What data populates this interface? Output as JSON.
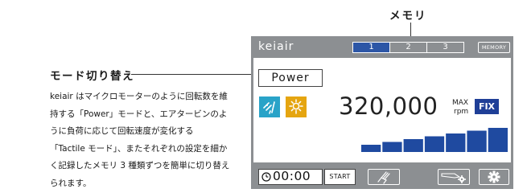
{
  "annotations": {
    "mode_title": "モード切り替え",
    "memory_title": "メモリ",
    "description_lines": [
      "keiair はマイクロモーターのように回転数を維",
      "持する「Power」モードと、エアタービンのよ",
      "うに負荷に応じて回転速度が変化する",
      "「Tactile モード」、またそれぞれの設定を細か",
      "く記録したメモリ 3 種類ずつを簡単に切り替え",
      "られます。"
    ]
  },
  "screen": {
    "title": "keiair",
    "memory_buttons": [
      {
        "label": "1",
        "active": true
      },
      {
        "label": "2",
        "active": false
      },
      {
        "label": "3",
        "active": false
      }
    ],
    "memory_button_label": "MEMORY",
    "mode_label": "Power",
    "speed_value": "320,000",
    "speed_unit_top": "MAX",
    "speed_unit_bottom": "rpm",
    "fix_label": "FIX",
    "speed_level": 1.0,
    "timer_value": "00:00",
    "start_label": "START",
    "icons": {
      "motor": "motor-icon",
      "light": "light-icon",
      "timer": "clock-icon",
      "clean": "cleaning-icon",
      "drill": "handpiece-settings-icon",
      "settings": "gear-icon"
    },
    "colors": {
      "chrome": "#8c8f92",
      "accent_blue": "#2c56a6",
      "fix_blue": "#1f3f97",
      "motor_teal": "#29a3c8",
      "light_amber": "#e5a510",
      "bar_blue": "#1f4aa0"
    }
  }
}
